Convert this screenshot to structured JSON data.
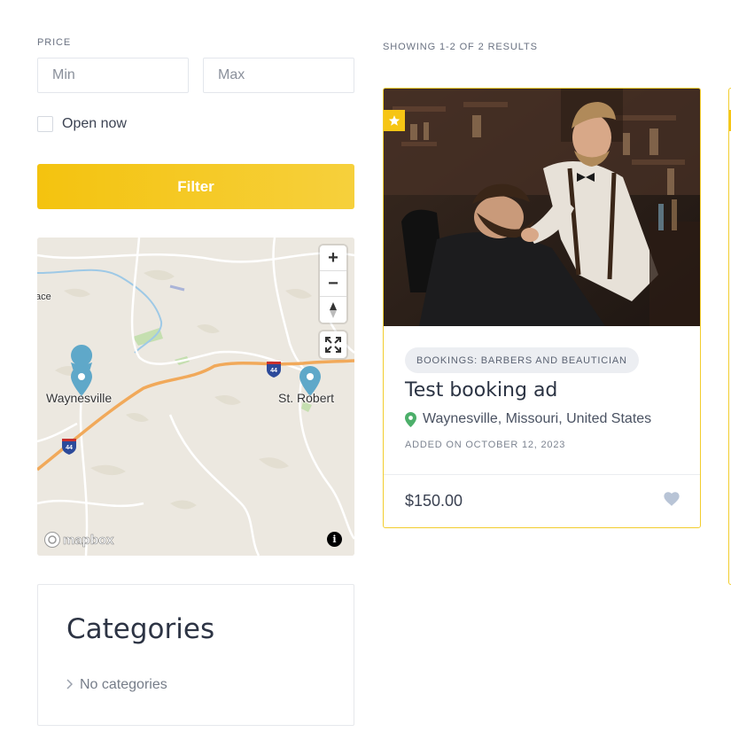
{
  "filters": {
    "price_label": "PRICE",
    "min_placeholder": "Min",
    "max_placeholder": "Max",
    "min_value": "",
    "max_value": "",
    "open_now_label": "Open now",
    "open_now_checked": false,
    "filter_button_label": "Filter"
  },
  "map": {
    "labels": [
      "Waynesville",
      "St. Robert",
      "ace"
    ],
    "highway_shield": "44",
    "attribution_logo": "mapbox",
    "zoom_in": "+",
    "zoom_out": "−",
    "info": "i"
  },
  "categories_widget": {
    "title": "Categories",
    "empty_text": "No categories"
  },
  "results": {
    "count_text": "SHOWING 1-2 OF 2 RESULTS",
    "listings": [
      {
        "category": "BOOKINGS: BARBERS AND BEAUTICIAN",
        "title": "Test booking ad",
        "location": "Waynesville, Missouri, United States",
        "added_on": "ADDED ON OCTOBER 12, 2023",
        "price": "$150.00",
        "featured": true
      }
    ]
  },
  "colors": {
    "accent": "#f4c30f",
    "card_border": "#f2cd2e",
    "pin": "#5fa8c9",
    "location_pin": "#4caf6a",
    "heart": "#b8c4d6"
  },
  "icons": [
    "star-icon",
    "location-pin-icon",
    "heart-icon",
    "chevron-right-icon",
    "fullscreen-icon",
    "compass-icon",
    "info-icon",
    "map-marker-icon"
  ]
}
